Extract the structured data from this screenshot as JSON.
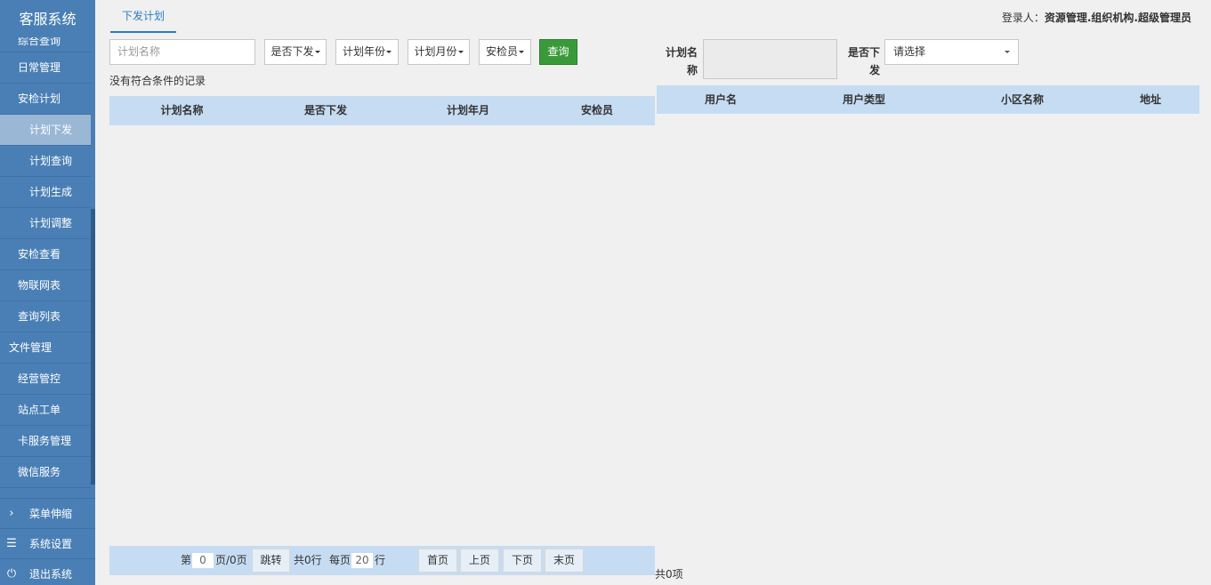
{
  "app": {
    "title": "客服系统"
  },
  "sidebar": {
    "partial_item": "综合查询",
    "items": [
      {
        "label": "日常管理",
        "type": "item"
      },
      {
        "label": "安检计划",
        "type": "item"
      },
      {
        "label": "计划下发",
        "type": "sub",
        "active": true
      },
      {
        "label": "计划查询",
        "type": "sub"
      },
      {
        "label": "计划生成",
        "type": "sub"
      },
      {
        "label": "计划调整",
        "type": "sub"
      },
      {
        "label": "安检查看",
        "type": "item"
      },
      {
        "label": "物联网表",
        "type": "item"
      },
      {
        "label": "查询列表",
        "type": "item"
      },
      {
        "label": "文件管理",
        "type": "root"
      },
      {
        "label": "经营管控",
        "type": "item"
      },
      {
        "label": "站点工单",
        "type": "item"
      },
      {
        "label": "卡服务管理",
        "type": "item"
      },
      {
        "label": "微信服务",
        "type": "item"
      }
    ],
    "bottom": [
      {
        "label": "菜单伸缩",
        "icon": "chevron-right-icon",
        "glyph": "›"
      },
      {
        "label": "系统设置",
        "icon": "menu-lines-icon",
        "glyph": "☰"
      },
      {
        "label": "退出系统",
        "icon": "power-icon",
        "glyph": "⏻"
      }
    ]
  },
  "header": {
    "tab": "下发计划",
    "login_label": "登录人：",
    "login_user": "资源管理.组织机构.超级管理员"
  },
  "filter": {
    "plan_name_placeholder": "计划名称",
    "is_issued": "是否下发",
    "plan_year": "计划年份",
    "plan_month": "计划月份",
    "inspector": "安检员",
    "query_label": "查询"
  },
  "left_table": {
    "empty_text": "没有符合条件的记录",
    "columns": [
      "计划名称",
      "是否下发",
      "计划年月",
      "安检员"
    ]
  },
  "pager": {
    "prefix": "第",
    "page": "0",
    "page_suffix": "页/0页",
    "jump": "跳转",
    "total_rows": "共0行",
    "per_page_label": "每页",
    "per_page": "20",
    "row_unit": "行",
    "first": "首页",
    "prev": "上页",
    "next": "下页",
    "last": "末页"
  },
  "right_panel": {
    "plan_name_label_1": "计划名",
    "plan_name_label_2": "称",
    "is_issued_label_1": "是否下",
    "is_issued_label_2": "发",
    "select_placeholder": "请选择",
    "columns": [
      "用户名",
      "用户类型",
      "小区名称",
      "地址"
    ],
    "total": "共0项"
  }
}
